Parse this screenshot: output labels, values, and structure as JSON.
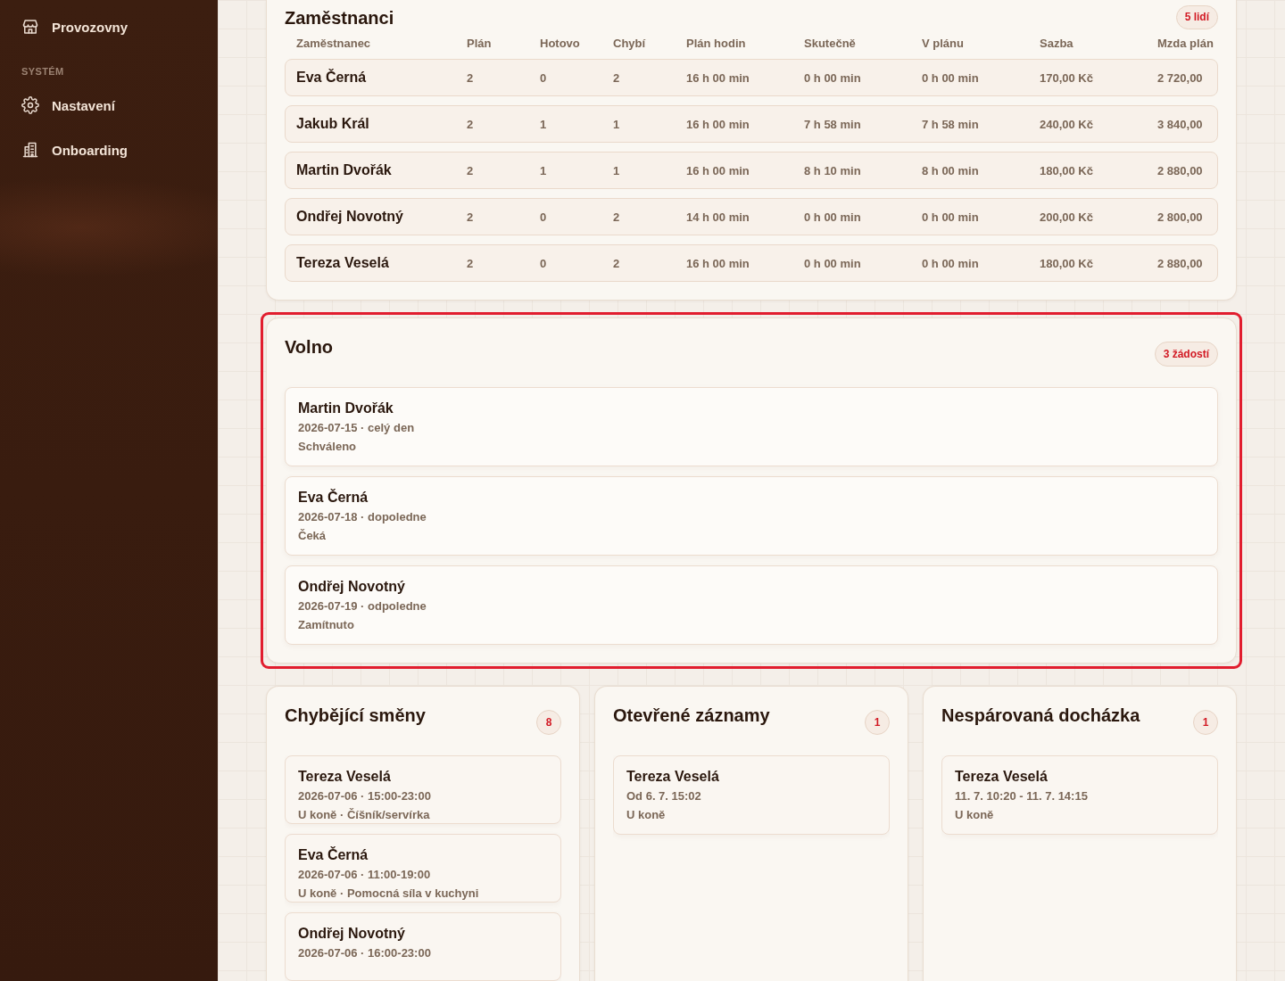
{
  "sidebar": {
    "items": [
      {
        "label": "Provozovny"
      }
    ],
    "sections": [
      {
        "heading": "SYSTÉM",
        "items": [
          {
            "label": "Nastavení"
          },
          {
            "label": "Onboarding"
          }
        ]
      }
    ]
  },
  "employees": {
    "title": "Zaměstnanci",
    "badge": "5 lidí",
    "columns": [
      "Zaměstnanec",
      "Plán",
      "Hotovo",
      "Chybí",
      "Plán hodin",
      "Skutečně",
      "V plánu",
      "Sazba",
      "Mzda plán"
    ],
    "rows": [
      {
        "cells": [
          "Eva Černá",
          "2",
          "0",
          "2",
          "16 h 00 min",
          "0 h 00 min",
          "0 h 00 min",
          "170,00 Kč",
          "2 720,00"
        ]
      },
      {
        "cells": [
          "Jakub Král",
          "2",
          "1",
          "1",
          "16 h 00 min",
          "7 h 58 min",
          "7 h 58 min",
          "240,00 Kč",
          "3 840,00"
        ]
      },
      {
        "cells": [
          "Martin Dvořák",
          "2",
          "1",
          "1",
          "16 h 00 min",
          "8 h 10 min",
          "8 h 00 min",
          "180,00 Kč",
          "2 880,00"
        ]
      },
      {
        "cells": [
          "Ondřej Novotný",
          "2",
          "0",
          "2",
          "14 h 00 min",
          "0 h 00 min",
          "0 h 00 min",
          "200,00 Kč",
          "2 800,00"
        ]
      },
      {
        "cells": [
          "Tereza Veselá",
          "2",
          "0",
          "2",
          "16 h 00 min",
          "0 h 00 min",
          "0 h 00 min",
          "180,00 Kč",
          "2 880,00"
        ]
      }
    ]
  },
  "time_off": {
    "title": "Volno",
    "badge": "3 žádostí",
    "highlighted": true,
    "items": [
      {
        "name": "Martin Dvořák",
        "when": "2026-07-15 · celý den",
        "status": "Schváleno"
      },
      {
        "name": "Eva Černá",
        "when": "2026-07-18 · dopoledne",
        "status": "Čeká"
      },
      {
        "name": "Ondřej Novotný",
        "when": "2026-07-19 · odpoledne",
        "status": "Zamítnuto"
      }
    ]
  },
  "panels": [
    {
      "title": "Chybějící směny",
      "badge": "8",
      "items": [
        {
          "name": "Tereza Veselá",
          "when": "2026-07-06 · 15:00-23:00",
          "detail": "U koně · Číšník/servírka"
        },
        {
          "name": "Eva Černá",
          "when": "2026-07-06 · 11:00-19:00",
          "detail": "U koně · Pomocná síla v kuchyni"
        },
        {
          "name": "Ondřej Novotný",
          "when": "2026-07-06 · 16:00-23:00"
        }
      ]
    },
    {
      "title": "Otevřené záznamy",
      "badge": "1",
      "items": [
        {
          "name": "Tereza Veselá",
          "when": "Od 6. 7. 15:02",
          "detail": "U koně"
        }
      ]
    },
    {
      "title": "Nespárovaná docházka",
      "badge": "1",
      "items": [
        {
          "name": "Tereza Veselá",
          "when": "11. 7. 10:20 - 11. 7. 14:15",
          "detail": "U koně"
        }
      ]
    }
  ]
}
